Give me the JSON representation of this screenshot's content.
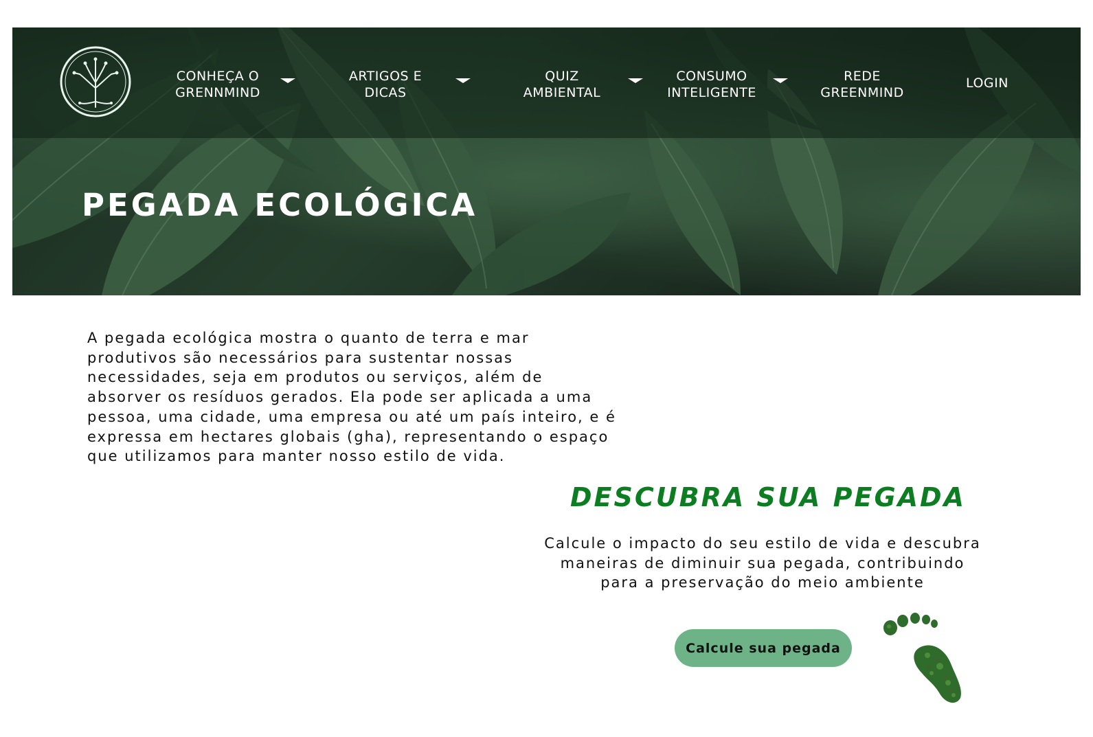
{
  "header": {
    "logo_icon": "tree-circuit-logo-icon",
    "nav": [
      {
        "label": "CONHEÇA O\nGRENNMIND",
        "has_dropdown": true
      },
      {
        "label": "ARTIGOS E\nDICAS",
        "has_dropdown": true
      },
      {
        "label": "QUIZ\nAMBIENTAL",
        "has_dropdown": true
      },
      {
        "label": "CONSUMO\nINTELIGENTE",
        "has_dropdown": true
      },
      {
        "label": "REDE\nGREENMIND",
        "has_dropdown": false
      },
      {
        "label": "LOGIN",
        "has_dropdown": false
      }
    ]
  },
  "hero": {
    "title": "PEGADA ECOLÓGICA",
    "background": "green-leaves-photo"
  },
  "intro": {
    "text": "A pegada ecológica mostra o quanto de terra e mar produtivos são necessários para sustentar nossas necessidades, seja em produtos ou serviços, além de absorver os resíduos gerados. Ela pode ser aplicada a uma pessoa, uma cidade, uma empresa ou até um país inteiro, e é expressa em hectares globais (gha), representando o espaço que utilizamos para manter nosso estilo de vida."
  },
  "cta": {
    "title": "DESCUBRA SUA PEGADA",
    "text": "Calcule o impacto do seu estilo de vida e descubra maneiras de diminuir sua pegada, contribuindo para a preservação do meio ambiente",
    "button_label": "Calcule sua pegada",
    "image": "green-footprint-icon"
  },
  "colors": {
    "accent_green": "#0d7d22",
    "button_green": "#6db387",
    "nav_band": "#122218"
  }
}
